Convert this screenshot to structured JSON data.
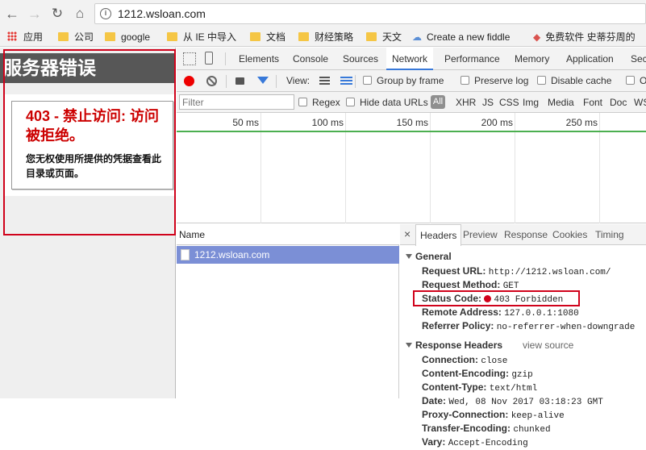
{
  "browser": {
    "url": "1212.wsloan.com",
    "bookmarks": [
      {
        "label": "应用",
        "icon": "apps-grid-icon"
      },
      {
        "label": "公司",
        "icon": "folder-icon"
      },
      {
        "label": "google",
        "icon": "folder-icon"
      },
      {
        "label": "从 IE 中导入",
        "icon": "folder-icon"
      },
      {
        "label": "文档",
        "icon": "folder-icon"
      },
      {
        "label": "财经策略",
        "icon": "folder-icon"
      },
      {
        "label": "天文",
        "icon": "folder-icon"
      },
      {
        "label": "Create a new fiddle",
        "icon": "cloud-icon"
      },
      {
        "label": "免费软件 史蒂芬周的",
        "icon": "diamond-icon"
      }
    ]
  },
  "page": {
    "header": "服务器错误",
    "error_title": "403 - 禁止访问: 访问被拒绝。",
    "error_message": "您无权使用所提供的凭据查看此目录或页面。"
  },
  "devtools": {
    "tabs": [
      "Elements",
      "Console",
      "Sources",
      "Network",
      "Performance",
      "Memory",
      "Application",
      "Sec"
    ],
    "active_tab": "Network",
    "toolbar": {
      "view": "View:",
      "group_by_frame": "Group by frame",
      "preserve_log": "Preserve log",
      "disable_cache": "Disable cache",
      "offline": "O"
    },
    "filter": {
      "placeholder": "Filter",
      "regex": "Regex",
      "hide_data_urls": "Hide data URLs",
      "all": "All",
      "types": [
        "XHR",
        "JS",
        "CSS",
        "Img",
        "Media",
        "Font",
        "Doc",
        "WS"
      ]
    },
    "timeline_ticks": [
      "50 ms",
      "100 ms",
      "150 ms",
      "200 ms",
      "250 ms"
    ],
    "name_header": "Name",
    "request_name": "1212.wsloan.com",
    "detail_tabs": [
      "Headers",
      "Preview",
      "Response",
      "Cookies",
      "Timing"
    ],
    "general": {
      "title": "General",
      "rows": [
        {
          "k": "Request URL:",
          "v": "http://1212.wsloan.com/"
        },
        {
          "k": "Request Method:",
          "v": "GET"
        },
        {
          "k": "Status Code:",
          "v": "403 Forbidden"
        },
        {
          "k": "Remote Address:",
          "v": "127.0.0.1:1080"
        },
        {
          "k": "Referrer Policy:",
          "v": "no-referrer-when-downgrade"
        }
      ]
    },
    "response_headers": {
      "title": "Response Headers",
      "view_source": "view source",
      "rows": [
        {
          "k": "Connection:",
          "v": "close"
        },
        {
          "k": "Content-Encoding:",
          "v": "gzip"
        },
        {
          "k": "Content-Type:",
          "v": "text/html"
        },
        {
          "k": "Date:",
          "v": "Wed, 08 Nov 2017 03:18:23 GMT"
        },
        {
          "k": "Proxy-Connection:",
          "v": "keep-alive"
        },
        {
          "k": "Transfer-Encoding:",
          "v": "chunked"
        },
        {
          "k": "Vary:",
          "v": "Accept-Encoding"
        }
      ]
    }
  }
}
